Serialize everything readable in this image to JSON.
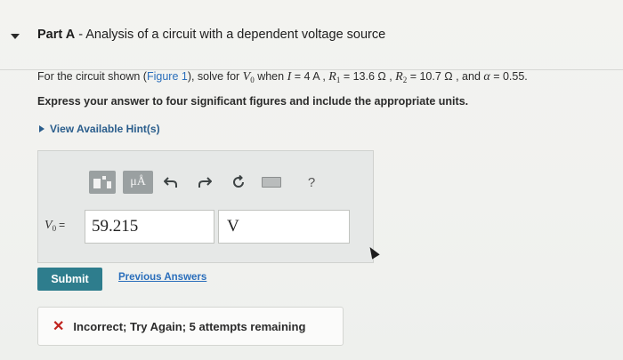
{
  "part": {
    "prefix": "Part A",
    "separator": " - ",
    "title": "Analysis of a circuit with a dependent voltage source"
  },
  "question": {
    "lead": "For the circuit shown (",
    "figure_link": "Figure 1",
    "mid": "), solve for ",
    "target_var": "V",
    "target_sub": "0",
    "when": " when ",
    "I_var": "I",
    "I_val": " = 4 A , ",
    "R1_var": "R",
    "R1_sub": "1",
    "R1_val": " = 13.6 Ω , ",
    "R2_var": "R",
    "R2_sub": "2",
    "R2_val": " = 10.7 Ω , and ",
    "alpha_var": "α",
    "alpha_val": " = 0.55."
  },
  "instruction": "Express your answer to four significant figures and include the appropriate units.",
  "hints_label": "View Available Hint(s)",
  "toolbar": {
    "mu_label": "μÅ",
    "help_label": "?"
  },
  "answer": {
    "var": "V",
    "sub": "0",
    "eq": "=",
    "value": "59.215",
    "unit": "V"
  },
  "submit_label": "Submit",
  "previous_answers_label": "Previous Answers",
  "feedback": {
    "icon": "✕",
    "text": "Incorrect; Try Again; 5 attempts remaining",
    "icon_color": "#c0231e"
  },
  "colors": {
    "submit_bg": "#2e7d8d",
    "link": "#2a6ebb"
  }
}
